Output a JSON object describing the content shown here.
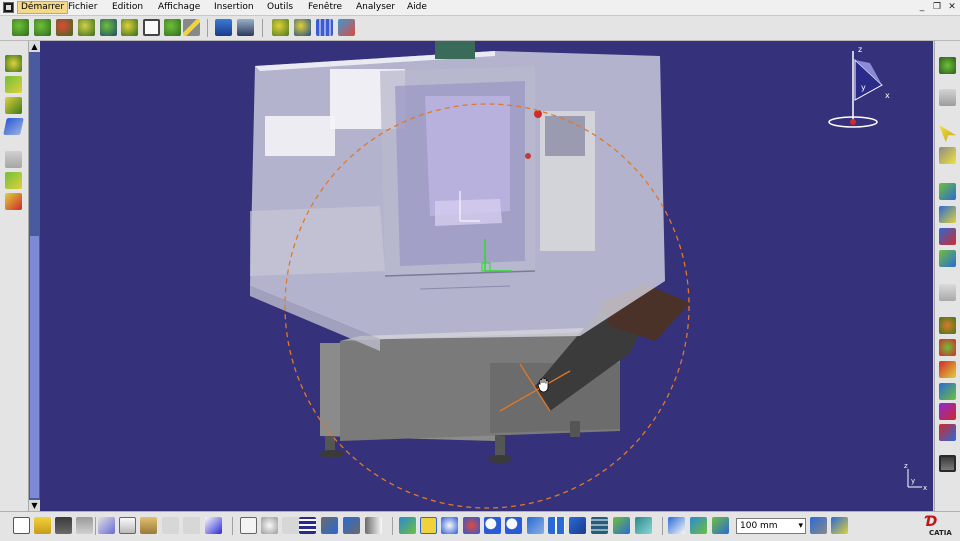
{
  "menubar": {
    "items": [
      {
        "label": "Démarrer",
        "active": true
      },
      {
        "label": "Fichier"
      },
      {
        "label": "Edition"
      },
      {
        "label": "Affichage"
      },
      {
        "label": "Insertion"
      },
      {
        "label": "Outils"
      },
      {
        "label": "Fenêtre"
      },
      {
        "label": "Analyser"
      },
      {
        "label": "Aide"
      }
    ],
    "window_controls": {
      "minimize": "_",
      "restore": "❐",
      "close": "✕"
    }
  },
  "toolbar_top": {
    "icons": [
      "constraint-icon",
      "constraint-defined-icon",
      "fix-icon",
      "fix-together-icon",
      "coincidence-icon",
      "contact-icon",
      "offset-icon",
      "angle-icon",
      "smart-move-icon",
      "explode-icon",
      "update-icon",
      "manipulate-icon"
    ]
  },
  "left_toolbar": {
    "icons": [
      "sketcher-icon",
      "plane-icon",
      "axis-system-icon",
      "part-design-icon",
      "constraint-icon",
      "analysis-icon",
      "delete-icon"
    ]
  },
  "right_toolbar": {
    "icons": [
      "insert-product-icon",
      "component-icon",
      "select-icon",
      "select-trap-icon",
      "measure-icon",
      "inertia-icon",
      "clash-icon",
      "sectioning-icon",
      "ruler-icon",
      "catalog-icon",
      "scene-icon",
      "material-icon",
      "parameter-icon",
      "knowledge-icon",
      "photo-icon",
      "save-icon"
    ]
  },
  "toolbar_bottom": {
    "icons": [
      "new-icon",
      "open-icon",
      "save-icon",
      "print-icon",
      "cut-icon",
      "copy-icon",
      "paste-icon",
      "undo-icon",
      "redo-icon",
      "whats-this-icon",
      "formula-icon",
      "comment-icon",
      "knowledge-icon",
      "table-icon",
      "catalog-icon",
      "tree-icon",
      "fly-icon",
      "fit-all-icon",
      "pan-icon",
      "rotate-icon",
      "zoom-in-icon",
      "zoom-out-icon",
      "normal-view-icon",
      "multi-view-icon",
      "iso-view-icon",
      "render-style-icon",
      "hide-show-icon",
      "swap-visible-icon",
      "compass-icon",
      "snap-icon",
      "measure-icon"
    ],
    "zoom_value": "100 mm"
  },
  "compass": {
    "x_label": "x",
    "y_label": "y",
    "z_label": "z"
  },
  "axis_indicator": {
    "x_label": "x",
    "y_label": "y",
    "z_label": "z"
  },
  "logo": {
    "text": "CATIA"
  },
  "colors": {
    "viewport_bg": "#35317a",
    "scroll_thumb": "#7f8ad6",
    "accent_orange": "#e0782a"
  }
}
